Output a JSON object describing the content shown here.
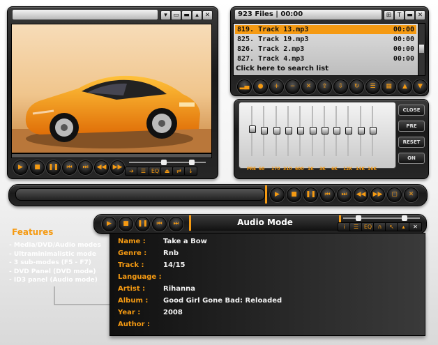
{
  "playlist": {
    "header": "923 Files | 00:00",
    "tracks": [
      {
        "num": "819. Track 13.mp3",
        "dur": "00:00",
        "selected": true
      },
      {
        "num": "825. Track 19.mp3",
        "dur": "00:00",
        "selected": false
      },
      {
        "num": "826. Track 2.mp3",
        "dur": "00:00",
        "selected": false
      },
      {
        "num": "827. Track 4.mp3",
        "dur": "00:00",
        "selected": false
      }
    ],
    "search_hint": "Click here to search list"
  },
  "equalizer": {
    "bands": [
      "PRE",
      "60",
      "170",
      "310",
      "600",
      "1K",
      "3K",
      "6K",
      "12K",
      "14K",
      "16K"
    ],
    "buttons": [
      "CLOSE",
      "PRE",
      "RESET",
      "ON"
    ]
  },
  "mini_eq_label": "EQ",
  "features": {
    "heading": "Features",
    "items": [
      "- Media/DVD/Audio modes",
      "- Ultraminimalistic mode",
      "- 3 sub-modes (F5 - F7)",
      "- DVD Panel (DVD mode)",
      "- ID3 panel (Audio mode)"
    ]
  },
  "audio_mode": {
    "title": "Audio Mode",
    "eq_label": "EQ",
    "fields": [
      {
        "label": "Name :",
        "value": "Take a Bow"
      },
      {
        "label": "Genre :",
        "value": "Rnb"
      },
      {
        "label": "Track :",
        "value": "14/15"
      },
      {
        "label": "Language :",
        "value": ""
      },
      {
        "label": "Artist :",
        "value": "Rihanna"
      },
      {
        "label": "Album :",
        "value": "Good Girl Gone Bad: Reloaded"
      },
      {
        "label": "Year :",
        "value": "2008"
      },
      {
        "label": "Author :",
        "value": ""
      }
    ]
  },
  "colors": {
    "accent": "#f59a12",
    "selected_row": "#f59a12",
    "panel": "#1e1e1e"
  }
}
